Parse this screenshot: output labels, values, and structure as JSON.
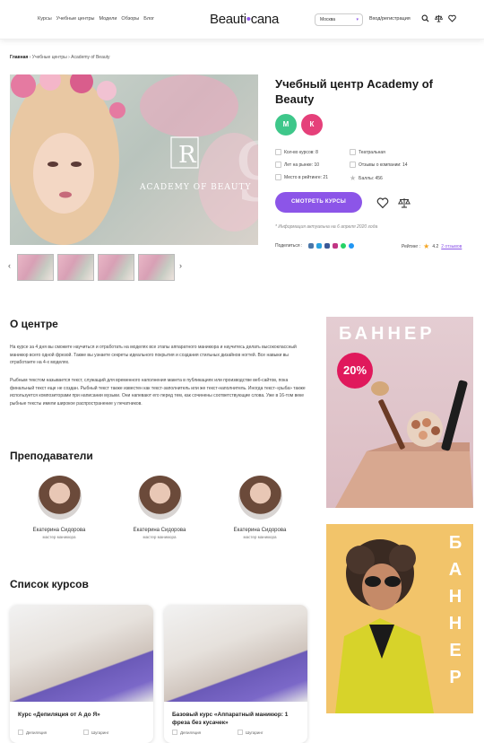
{
  "header": {
    "nav": [
      "Курсы",
      "Учебные центры",
      "Модели",
      "Обзоры",
      "Блог"
    ],
    "logo_left": "Beauti",
    "logo_dot": "•",
    "logo_right": "cana",
    "city": "Москва",
    "login": "Вход/регистрация",
    "accent": "#8c55e8"
  },
  "breadcrumb": {
    "home": "Главная",
    "sep1": " › ",
    "centers": "Учебные центры",
    "sep2": " › ",
    "current": "Academy of Beauty"
  },
  "center": {
    "title": "Учебный центр Academy of Beauty",
    "tags": [
      {
        "label": "М",
        "color": "#3ec78a"
      },
      {
        "label": "К",
        "color": "#e5407a"
      }
    ],
    "stats": [
      "Кол-во курсов: 8",
      "Театральная",
      "Лет на рынке: 10",
      "Отзывы о компании: 14",
      "Место в рейтинге: 21",
      "Баллы: 456"
    ],
    "button_label": "СМОТРЕТЬ КУРСЫ",
    "note": "* Информация актуальна на 6 апреля 2020 года",
    "share_label": "Поделиться :",
    "rating_label": "Рейтинг :",
    "rating_value": "4.2",
    "reviews": "2 отзывов",
    "logo_text": "ACADEMY OF BEAUTY"
  },
  "about": {
    "heading": "О центре",
    "p1": "На курсе за 4 дня вы сможете научиться и отработать на моделях все этапы аппаратного маникюра и научитесь делать высококлассный маникюр всего одной фрезой. Также вы узнаете секреты идеального покрытия и создания стильных дизайнов ногтей. Все навыки вы отработаете на 4-х моделях.",
    "p2": "Рыбным текстом называется текст, служащий для временного наполнения макета в публикациях или производстве веб-сайтов, пока финальный текст еще не создан. Рыбный текст также известен как текст-заполнитель или же текст-наполнитель. Иногда текст-«рыба» также используется композиторами при написании музыки. Они напевают его перед тем, как сочинены соответствующие слова. Уже в 16-том веке рыбные тексты имели широкое распространение у печатников."
  },
  "teachers": {
    "heading": "Преподаватели",
    "items": [
      {
        "name": "Екатерина Сидорова",
        "role": "мастер маникюра"
      },
      {
        "name": "Екатерина Сидорова",
        "role": "мастер маникюра"
      },
      {
        "name": "Екатерина Сидорова",
        "role": "мастер маникюра"
      }
    ]
  },
  "courses": {
    "heading": "Список курсов",
    "items": [
      {
        "title": "Курс «Депиляция от А до Я»",
        "meta1": "Депиляция",
        "meta2": "Шугаринг"
      },
      {
        "title": "Базовый курс «Аппаратный маникюр: 1 фреза без кусачек»",
        "meta1": "Депиляция",
        "meta2": "Шугаринг"
      }
    ]
  },
  "banners": {
    "banner1_text": "БАННЕР",
    "banner1_badge": "20%",
    "banner2_letters": [
      "Б",
      "А",
      "Н",
      "Н",
      "Е",
      "Р"
    ]
  }
}
